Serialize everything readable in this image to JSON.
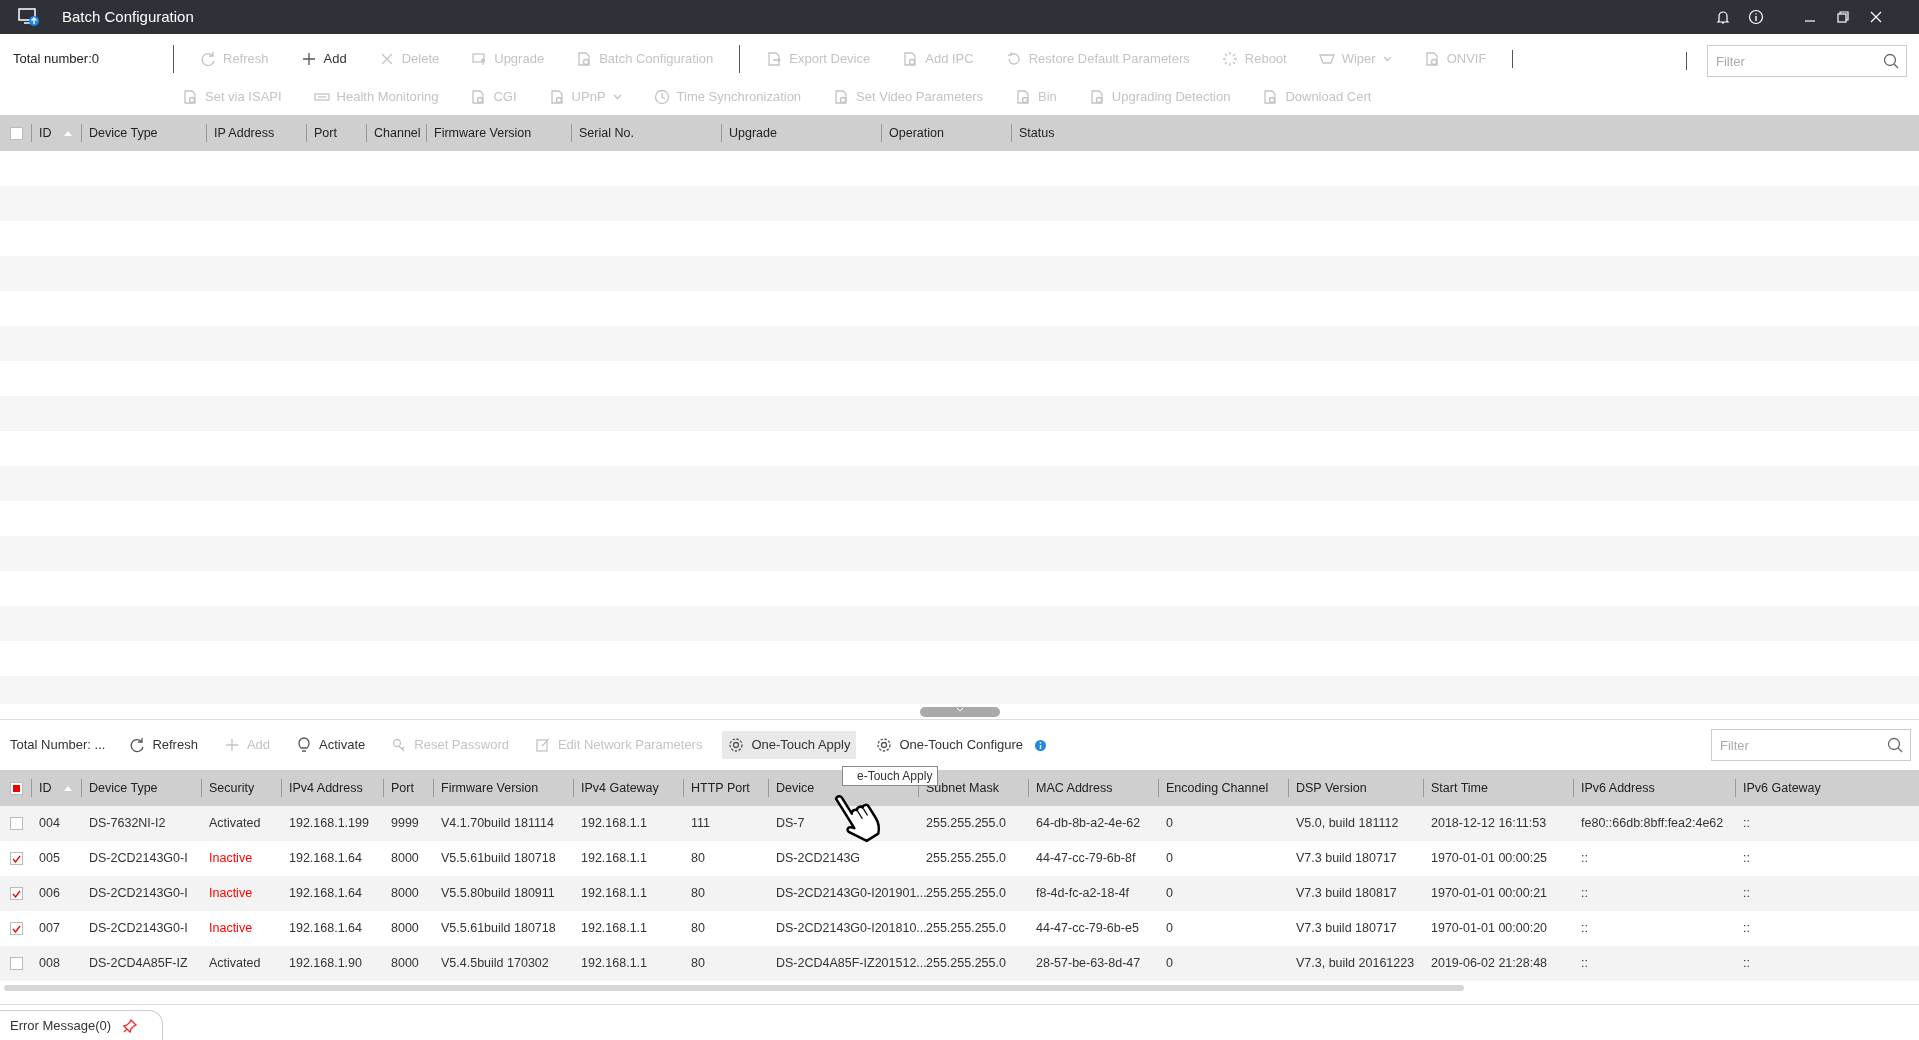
{
  "window": {
    "title": "Batch Configuration"
  },
  "top_panel": {
    "total": "Total number:0",
    "toolbar_row_1": [
      {
        "label": "Refresh",
        "disabled": true,
        "dropdown": false,
        "separator_before": true
      },
      {
        "label": "Add",
        "disabled": false,
        "dropdown": false,
        "separator_before": false
      },
      {
        "label": "Delete",
        "disabled": true,
        "dropdown": false,
        "separator_before": false
      },
      {
        "label": "Upgrade",
        "disabled": true,
        "dropdown": false,
        "separator_before": false
      },
      {
        "label": "Batch Configuration",
        "disabled": true,
        "dropdown": false,
        "separator_before": false
      },
      {
        "label": "Export Device",
        "disabled": true,
        "dropdown": false,
        "separator_before": true
      },
      {
        "label": "Add IPC",
        "disabled": true,
        "dropdown": false,
        "separator_before": false
      },
      {
        "label": "Restore Default Parameters",
        "disabled": true,
        "dropdown": false,
        "separator_before": false
      },
      {
        "label": "Reboot",
        "disabled": true,
        "dropdown": false,
        "separator_before": false
      },
      {
        "label": "Wiper",
        "disabled": true,
        "dropdown": true,
        "separator_before": false
      },
      {
        "label": "ONVIF",
        "disabled": true,
        "dropdown": false,
        "separator_before": false
      }
    ],
    "toolbar_row_2": [
      {
        "label": "Set via ISAPI",
        "disabled": true,
        "dropdown": false
      },
      {
        "label": "Health Monitoring",
        "disabled": true,
        "dropdown": false
      },
      {
        "label": "CGI",
        "disabled": true,
        "dropdown": false
      },
      {
        "label": "UPnP",
        "disabled": true,
        "dropdown": true
      },
      {
        "label": "Time Synchronization",
        "disabled": true,
        "dropdown": false
      },
      {
        "label": "Set Video Parameters",
        "disabled": true,
        "dropdown": false
      },
      {
        "label": "Bin",
        "disabled": true,
        "dropdown": false
      },
      {
        "label": "Upgrading Detection",
        "disabled": true,
        "dropdown": false
      },
      {
        "label": "Download Cert",
        "disabled": true,
        "dropdown": false
      }
    ],
    "filter": {
      "placeholder": "Filter"
    },
    "table": {
      "select_all_partial": false,
      "columns": [
        "ID",
        "Device Type",
        "IP Address",
        "Port",
        "Channel",
        "Firmware Version",
        "Serial No.",
        "Upgrade",
        "Operation",
        "Status"
      ]
    }
  },
  "bottom_panel": {
    "total": "Total Number: ...",
    "toolbar": [
      {
        "label": "Refresh",
        "disabled": false,
        "hovered": false
      },
      {
        "label": "Add",
        "disabled": true,
        "hovered": false
      },
      {
        "label": "Activate",
        "disabled": false,
        "hovered": false
      },
      {
        "label": "Reset Password",
        "disabled": true,
        "hovered": false
      },
      {
        "label": "Edit Network Parameters",
        "disabled": true,
        "hovered": false
      },
      {
        "label": "One-Touch Apply",
        "disabled": false,
        "hovered": true
      },
      {
        "label": "One-Touch Configure",
        "disabled": false,
        "hovered": false
      }
    ],
    "tooltip": "e-Touch Apply",
    "filter": {
      "placeholder": "Filter"
    },
    "table": {
      "select_all_partial": true,
      "columns": [
        "ID",
        "Device Type",
        "Security",
        "IPv4 Address",
        "Port",
        "Firmware Version",
        "IPv4 Gateway",
        "HTTP Port",
        "Device",
        "Subnet Mask",
        "MAC Address",
        "Encoding Channel",
        "DSP Version",
        "Start Time",
        "IPv6 Address",
        "IPv6 Gateway"
      ],
      "rows": [
        {
          "checked": false,
          "color": "#333333",
          "cells": [
            "004",
            "DS-7632NI-I2",
            "Activated",
            "192.168.1.199",
            "9999",
            "V4.1.70build 181114",
            "192.168.1.1",
            "111",
            "DS-7",
            "255.255.255.0",
            "64-db-8b-a2-4e-62",
            "0",
            "V5.0, build 181112",
            "2018-12-12 16:11:53",
            "fe80::66db:8bff:fea2:4e62",
            "::"
          ]
        },
        {
          "checked": true,
          "color": "#ff0000",
          "cells": [
            "005",
            "DS-2CD2143G0-I",
            "Inactive",
            "192.168.1.64",
            "8000",
            "V5.5.61build 180718",
            "192.168.1.1",
            "80",
            "DS-2CD2143G",
            "255.255.255.0",
            "44-47-cc-79-6b-8f",
            "0",
            "V7.3 build 180717",
            "1970-01-01 00:00:25",
            "::",
            "::"
          ]
        },
        {
          "checked": true,
          "color": "#ff0000",
          "cells": [
            "006",
            "DS-2CD2143G0-I",
            "Inactive",
            "192.168.1.64",
            "8000",
            "V5.5.80build 180911",
            "192.168.1.1",
            "80",
            "DS-2CD2143G0-I201901...",
            "255.255.255.0",
            "f8-4d-fc-a2-18-4f",
            "0",
            "V7.3 build 180817",
            "1970-01-01 00:00:21",
            "::",
            "::"
          ]
        },
        {
          "checked": true,
          "color": "#ff0000",
          "cells": [
            "007",
            "DS-2CD2143G0-I",
            "Inactive",
            "192.168.1.64",
            "8000",
            "V5.5.61build 180718",
            "192.168.1.1",
            "80",
            "DS-2CD2143G0-I201810...",
            "255.255.255.0",
            "44-47-cc-79-6b-e5",
            "0",
            "V7.3 build 180717",
            "1970-01-01 00:00:20",
            "::",
            "::"
          ]
        },
        {
          "checked": false,
          "color": "#333333",
          "cells": [
            "008",
            "DS-2CD4A85F-IZ",
            "Activated",
            "192.168.1.90",
            "8000",
            "V5.4.5build 170302",
            "192.168.1.1",
            "80",
            "DS-2CD4A85F-IZ201512...",
            "255.255.255.0",
            "28-57-be-63-8d-47",
            "0",
            "V7.3, build 20161223",
            "2019-06-02 21:28:48",
            "::",
            "::"
          ]
        }
      ]
    }
  },
  "status_bar": {
    "error_tab": "Error Message(0)"
  }
}
